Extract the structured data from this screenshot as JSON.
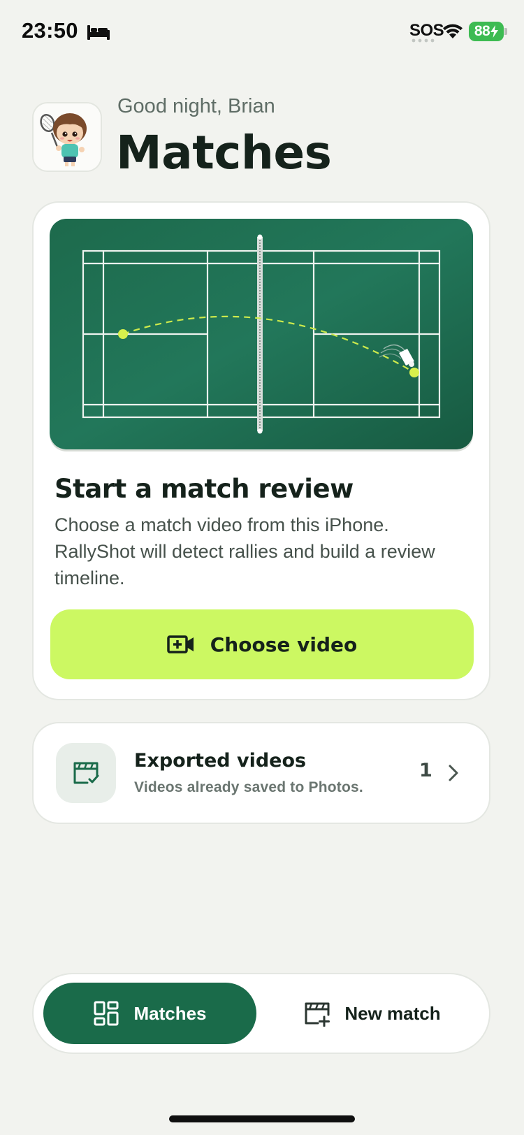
{
  "status_bar": {
    "time": "23:50",
    "carrier": "SOS",
    "battery": "88"
  },
  "header": {
    "greeting": "Good night, Brian",
    "title": "Matches"
  },
  "review_card": {
    "heading": "Start a match review",
    "body": "Choose a match video from this iPhone. RallyShot will detect rallies and build a review timeline.",
    "button_label": "Choose video"
  },
  "exported": {
    "title": "Exported videos",
    "subtitle": "Videos already saved to Photos.",
    "count": "1"
  },
  "tabs": [
    {
      "label": "Matches",
      "icon": "grid-icon",
      "active": true
    },
    {
      "label": "New match",
      "icon": "clapper-plus-icon",
      "active": false
    }
  ],
  "colors": {
    "brand_green": "#1a6b4a",
    "accent_lime": "#ccf862",
    "court_green": "#1c6b4d",
    "background": "#f2f3ef",
    "battery_green": "#3dbb52"
  }
}
